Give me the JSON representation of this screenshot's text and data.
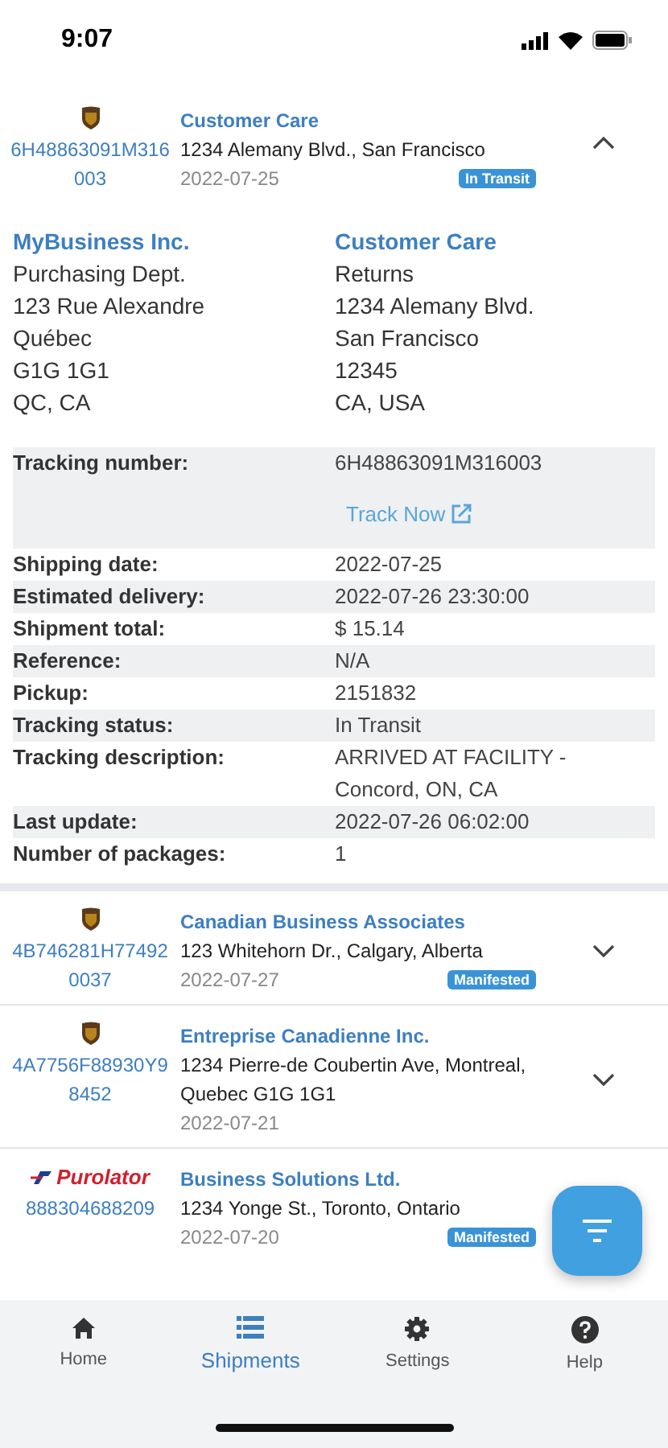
{
  "status_bar": {
    "time": "9:07"
  },
  "expanded_shipment": {
    "carrier": {
      "kind": "ups"
    },
    "tracking": "6H48863091M316003",
    "recipient": "Customer Care",
    "address": "1234 Alemany Blvd., San Francisco",
    "date": "2022-07-25",
    "status": "In Transit",
    "expanded": true,
    "from": {
      "name": "MyBusiness Inc.",
      "lines": [
        "Purchasing Dept.",
        "123 Rue Alexandre",
        "Québec",
        "G1G 1G1",
        "QC, CA"
      ]
    },
    "to": {
      "name": "Customer Care",
      "lines": [
        "Returns",
        "1234 Alemany Blvd.",
        "San Francisco",
        "12345",
        "CA, USA"
      ]
    },
    "tracking_row": {
      "label": "Tracking number:",
      "value": "6H48863091M316003",
      "link": "Track Now"
    },
    "details": [
      {
        "label": "Shipping date:",
        "value": "2022-07-25"
      },
      {
        "label": "Estimated delivery:",
        "value": "2022-07-26 23:30:00"
      },
      {
        "label": "Shipment total:",
        "value": "$ 15.14"
      },
      {
        "label": "Reference:",
        "value": "N/A"
      },
      {
        "label": "Pickup:",
        "value": "2151832"
      },
      {
        "label": "Tracking status:",
        "value": "In Transit"
      },
      {
        "label": "Tracking description:",
        "value": "ARRIVED AT FACILITY - Concord, ON, CA"
      },
      {
        "label": "Last update:",
        "value": "2022-07-26 06:02:00"
      },
      {
        "label": "Number of packages:",
        "value": "1"
      }
    ]
  },
  "shipments": [
    {
      "carrier": {
        "kind": "ups"
      },
      "tracking": "4B746281H774920037",
      "recipient": "Canadian Business Associates",
      "address": "123 Whitehorn Dr., Calgary, Alberta",
      "date": "2022-07-27",
      "status": "Manifested",
      "expanded": false
    },
    {
      "carrier": {
        "kind": "ups"
      },
      "tracking": "4A7756F88930Y98452",
      "recipient": "Entreprise Canadienne Inc.",
      "address": "1234 Pierre-de Coubertin Ave, Montreal, Quebec G1G 1G1",
      "date": "2022-07-21",
      "expanded": false
    },
    {
      "carrier": {
        "kind": "purolator",
        "label": "Purolator"
      },
      "tracking": "888304688209",
      "recipient": "Business Solutions Ltd.",
      "address": "1234 Yonge St., Toronto, Ontario",
      "date": "2022-07-20",
      "status": "Manifested"
    }
  ],
  "tabs": [
    {
      "kind": "home",
      "label": "Home",
      "selected": false
    },
    {
      "kind": "list",
      "label": "Shipments",
      "selected": true
    },
    {
      "kind": "settings",
      "label": "Settings",
      "selected": false
    },
    {
      "kind": "help",
      "label": "Help",
      "selected": false
    }
  ]
}
